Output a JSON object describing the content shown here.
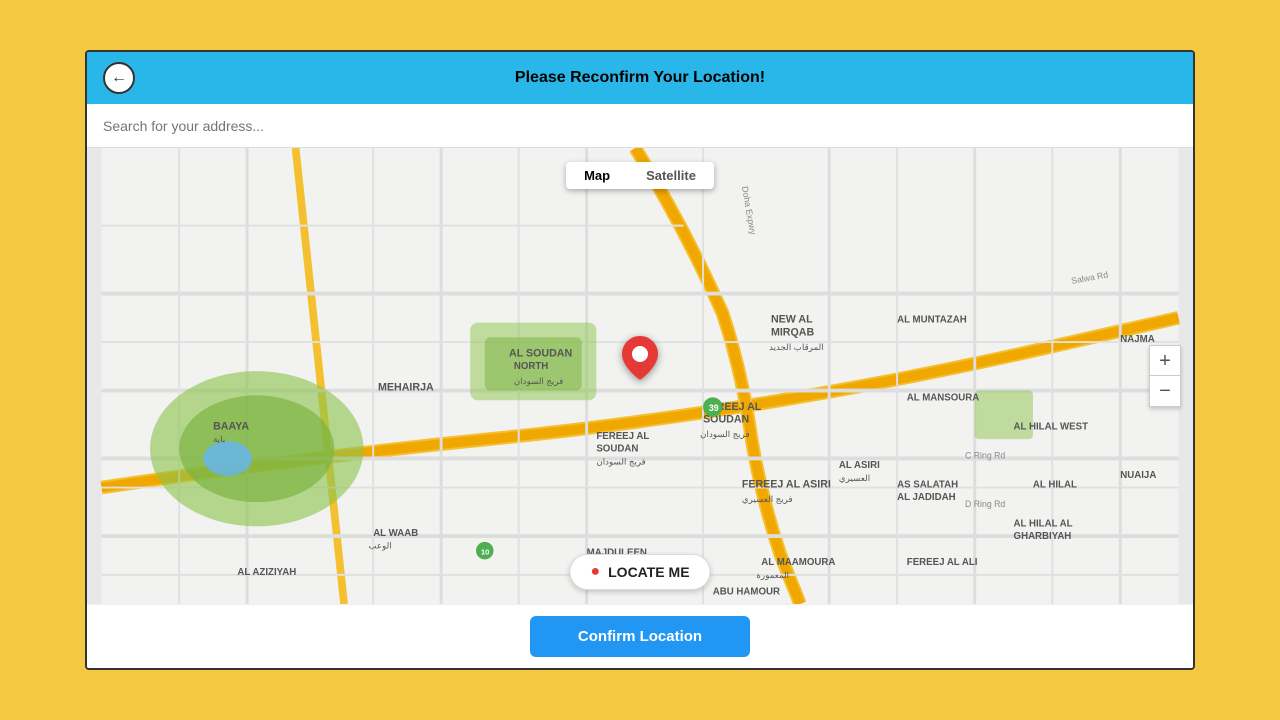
{
  "header": {
    "title": "Please Reconfirm Your Location!",
    "back_label": "←"
  },
  "search": {
    "placeholder": "Search for your address..."
  },
  "map": {
    "tab_map": "Map",
    "tab_satellite": "Satellite",
    "zoom_in": "+",
    "zoom_out": "−"
  },
  "locate_me": {
    "label": "LOCATE ME"
  },
  "confirm": {
    "label": "Confirm Location"
  }
}
